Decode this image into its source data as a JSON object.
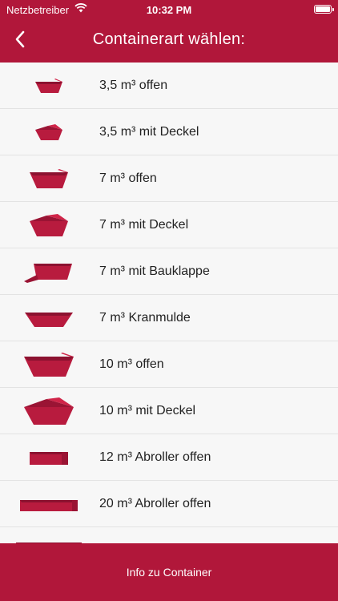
{
  "status": {
    "carrier": "Netzbetreiber",
    "time": "10:32 PM"
  },
  "header": {
    "title": "Containerart wählen:"
  },
  "colors": {
    "accent": "#b1173a",
    "container": "#b81b3e"
  },
  "items": [
    {
      "label": "3,5 m³ offen",
      "icon": "small-open-skip-icon"
    },
    {
      "label": "3,5 m³ mit Deckel",
      "icon": "small-lidded-skip-icon"
    },
    {
      "label": "7 m³ offen",
      "icon": "open-skip-icon"
    },
    {
      "label": "7 m³ mit Deckel",
      "icon": "lidded-skip-icon"
    },
    {
      "label": "7 m³ mit Bauklappe",
      "icon": "skip-with-flap-icon"
    },
    {
      "label": "7 m³ Kranmulde",
      "icon": "crane-skip-icon"
    },
    {
      "label": "10 m³ offen",
      "icon": "large-open-skip-icon"
    },
    {
      "label": "10 m³ mit Deckel",
      "icon": "large-lidded-skip-icon"
    },
    {
      "label": "12 m³ Abroller offen",
      "icon": "roll-off-container-icon"
    },
    {
      "label": "20 m³ Abroller offen",
      "icon": "large-roll-off-container-icon"
    },
    {
      "label": "",
      "icon": "roll-off-container-icon"
    }
  ],
  "footer": {
    "label": "Info zu Container"
  }
}
